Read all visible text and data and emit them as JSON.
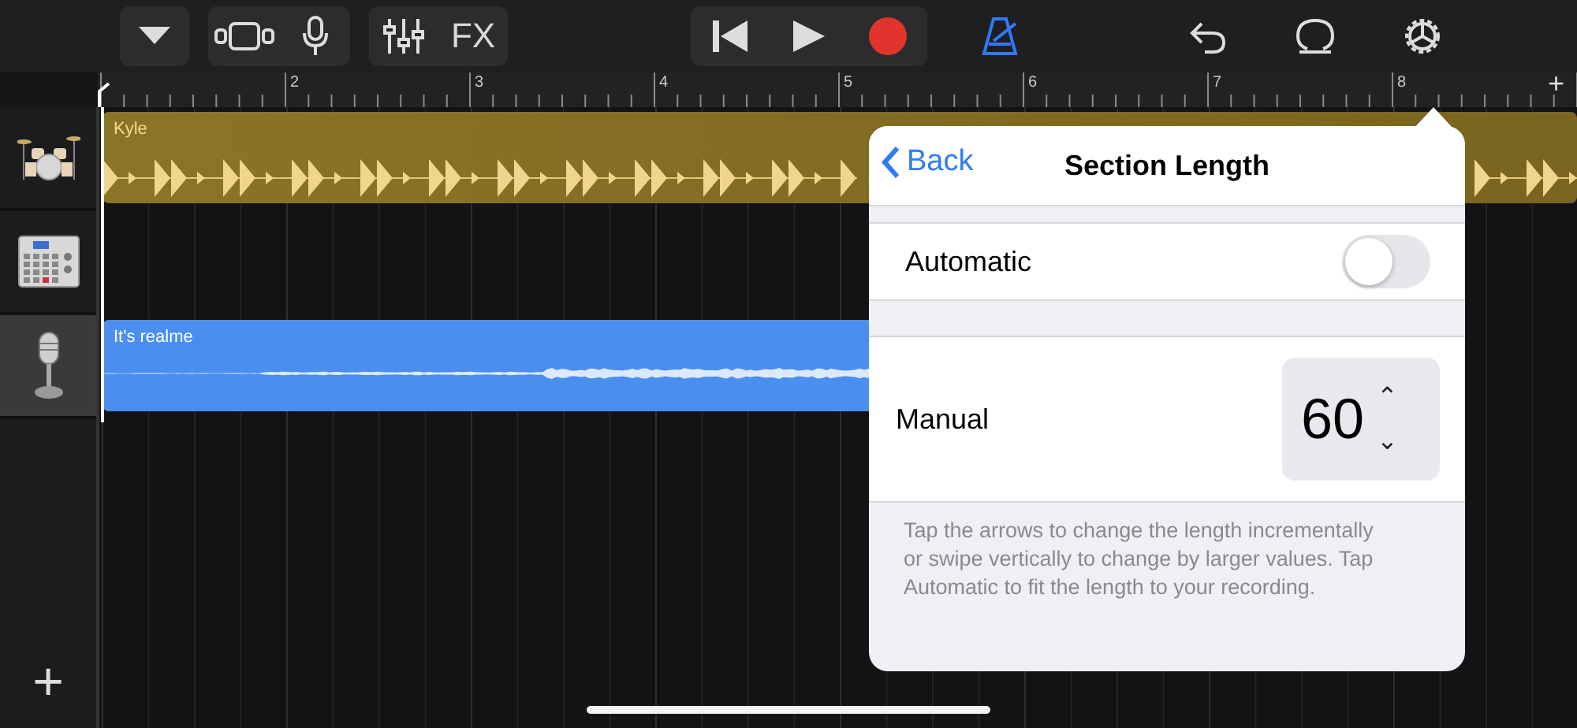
{
  "toolbar": {
    "fx": "FX",
    "metronome_on": true,
    "recording": false
  },
  "ruler": {
    "bars": [
      "2",
      "3",
      "4",
      "5",
      "6",
      "7",
      "8"
    ],
    "add": "+"
  },
  "tracks": [
    {
      "kind": "drums",
      "selected": false,
      "region": {
        "kind": "beats",
        "name": "Kyle"
      }
    },
    {
      "kind": "beat-sequencer",
      "selected": false
    },
    {
      "kind": "microphone",
      "selected": true,
      "region": {
        "kind": "audio",
        "name": "It's realme"
      }
    }
  ],
  "add_track": "+",
  "popover": {
    "back": "Back",
    "title": "Section Length",
    "automatic": {
      "label": "Automatic",
      "on": false
    },
    "manual": {
      "label": "Manual",
      "value": "60",
      "up": "⌃",
      "down": "⌄"
    },
    "footer": "Tap the arrows to change the length incrementally or swipe vertically to change by larger values. Tap Automatic to fit the length to your recording."
  }
}
